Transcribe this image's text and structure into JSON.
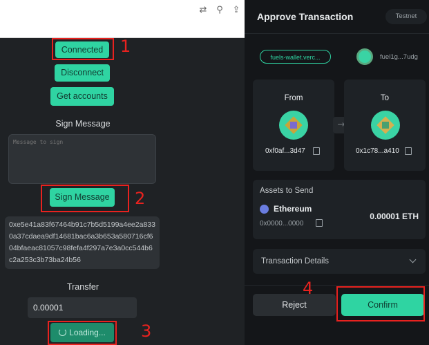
{
  "browser": {
    "toolbar_icons": [
      "translate-icon",
      "zoom-icon",
      "share-icon"
    ],
    "toolbar_glyphs": [
      "⇄",
      "⚲",
      "⇪"
    ]
  },
  "app": {
    "connected_label": "Connected",
    "disconnect_label": "Disconnect",
    "get_accounts_label": "Get accounts",
    "sign_message_heading": "Sign Message",
    "message_placeholder": "Message to sign",
    "sign_message_button": "Sign Message",
    "signature_text": "0xe5e41a83f67464b91c7b5d5199a4ee2a8330a37cdaea9df14681bac6a3b653a580716cf604bfaeac81057c98fefa4f297a7e3a0cc544b6c2a253c3b73ba24b56",
    "transfer_heading": "Transfer",
    "transfer_amount": "0.00001",
    "loading_label": "Loading..."
  },
  "annotations": [
    "1",
    "2",
    "3",
    "4"
  ],
  "wallet": {
    "title": "Approve Transaction",
    "network": "Testnet",
    "origin": "fuels-wallet.verc...",
    "account_short": "fuel1g...7udg",
    "from_label": "From",
    "from_address": "0xf0af...3d47",
    "to_label": "To",
    "to_address": "0x1c78...a410",
    "arrow_glyph": "→",
    "assets_heading": "Assets to Send",
    "asset_name": "Ethereum",
    "asset_id": "0x0000...0000",
    "asset_amount": "0.00001 ETH",
    "details_label": "Transaction Details",
    "reject_label": "Reject",
    "confirm_label": "Confirm",
    "colors": {
      "accent": "#2fd4a2",
      "panel": "#141619",
      "annotation": "#e8221f"
    }
  }
}
